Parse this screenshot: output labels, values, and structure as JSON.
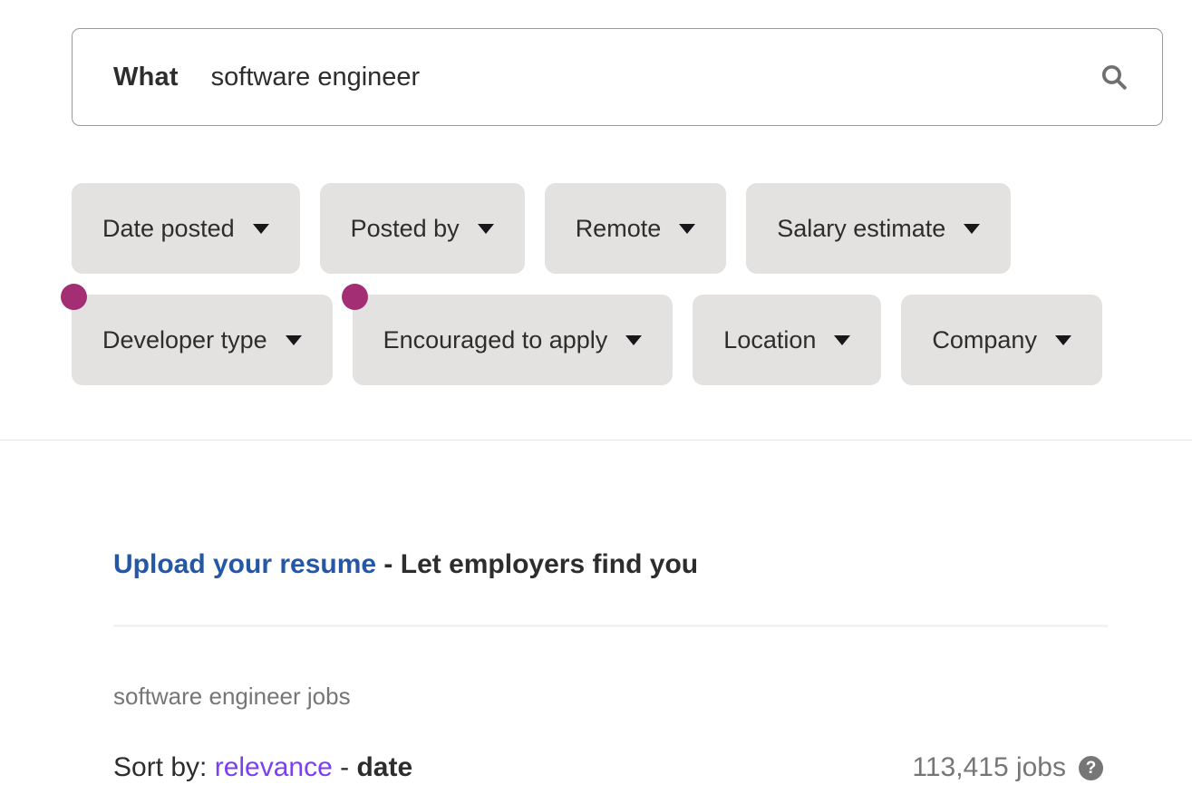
{
  "search": {
    "label": "What",
    "value": "software engineer",
    "placeholder": "Job title, keywords, or company",
    "submit_icon": "search-icon"
  },
  "filters": {
    "row1": [
      {
        "label": "Date posted",
        "caret": "chevron-down-icon",
        "new": false
      },
      {
        "label": "Posted by",
        "caret": "chevron-down-icon",
        "new": false
      },
      {
        "label": "Remote",
        "caret": "chevron-down-icon",
        "new": false
      },
      {
        "label": "Salary estimate",
        "caret": "chevron-down-icon",
        "new": false
      }
    ],
    "row2": [
      {
        "label": "Developer type",
        "caret": "chevron-down-icon",
        "new": true
      },
      {
        "label": "Encouraged to apply",
        "caret": "chevron-down-icon",
        "new": true
      },
      {
        "label": "Location",
        "caret": "chevron-down-icon",
        "new": false
      },
      {
        "label": "Company",
        "caret": "chevron-down-icon",
        "new": false
      }
    ]
  },
  "promo": {
    "link_text": "Upload your resume",
    "rest_text": " - Let employers find you"
  },
  "results": {
    "query_label": "software engineer jobs",
    "sort_prefix": "Sort by: ",
    "sort_relevance": "relevance",
    "sort_separator": " - ",
    "sort_date": "date",
    "count_text": "113,415 jobs",
    "help_icon_char": "?"
  },
  "colors": {
    "chip_bg": "#e4e2e0",
    "new_dot": "#A32E74",
    "link_blue": "#2557a7",
    "link_purple": "#7b3ff2",
    "muted_gray": "#767676",
    "text_dark": "#2d2d2d"
  }
}
